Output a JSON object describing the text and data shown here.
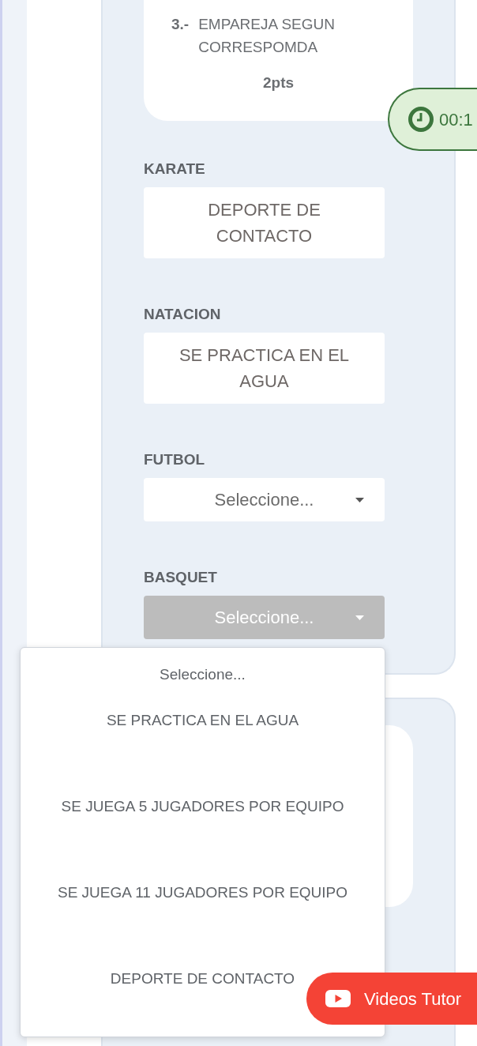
{
  "question": {
    "number": "3.-",
    "text": "EMPAREJA SEGUN CORRESPOMDA",
    "points": "2pts"
  },
  "timer": {
    "text": "00:1"
  },
  "pairs": [
    {
      "label": "KARATE",
      "kind": "answer",
      "value": "DEPORTE DE CONTACTO"
    },
    {
      "label": "NATACION",
      "kind": "answer",
      "value": "SE PRACTICA EN EL AGUA"
    },
    {
      "label": "FUTBOL",
      "kind": "select",
      "placeholder": "Seleccione...",
      "open": false
    },
    {
      "label": "BASQUET",
      "kind": "select",
      "placeholder": "Seleccione...",
      "open": true
    }
  ],
  "dropdown": {
    "options": [
      {
        "label": "Seleccione...",
        "kind": "placeholder"
      },
      {
        "label": "SE PRACTICA EN EL AGUA",
        "kind": "option"
      },
      {
        "label": "SE JUEGA 5 JUGADORES POR EQUIPO",
        "kind": "option"
      },
      {
        "label": "SE JUEGA 11 JUGADORES POR EQUIPO",
        "kind": "option"
      },
      {
        "label": "DEPORTE DE CONTACTO",
        "kind": "option"
      }
    ]
  },
  "tutorial_button": {
    "label": "Videos Tutor"
  }
}
